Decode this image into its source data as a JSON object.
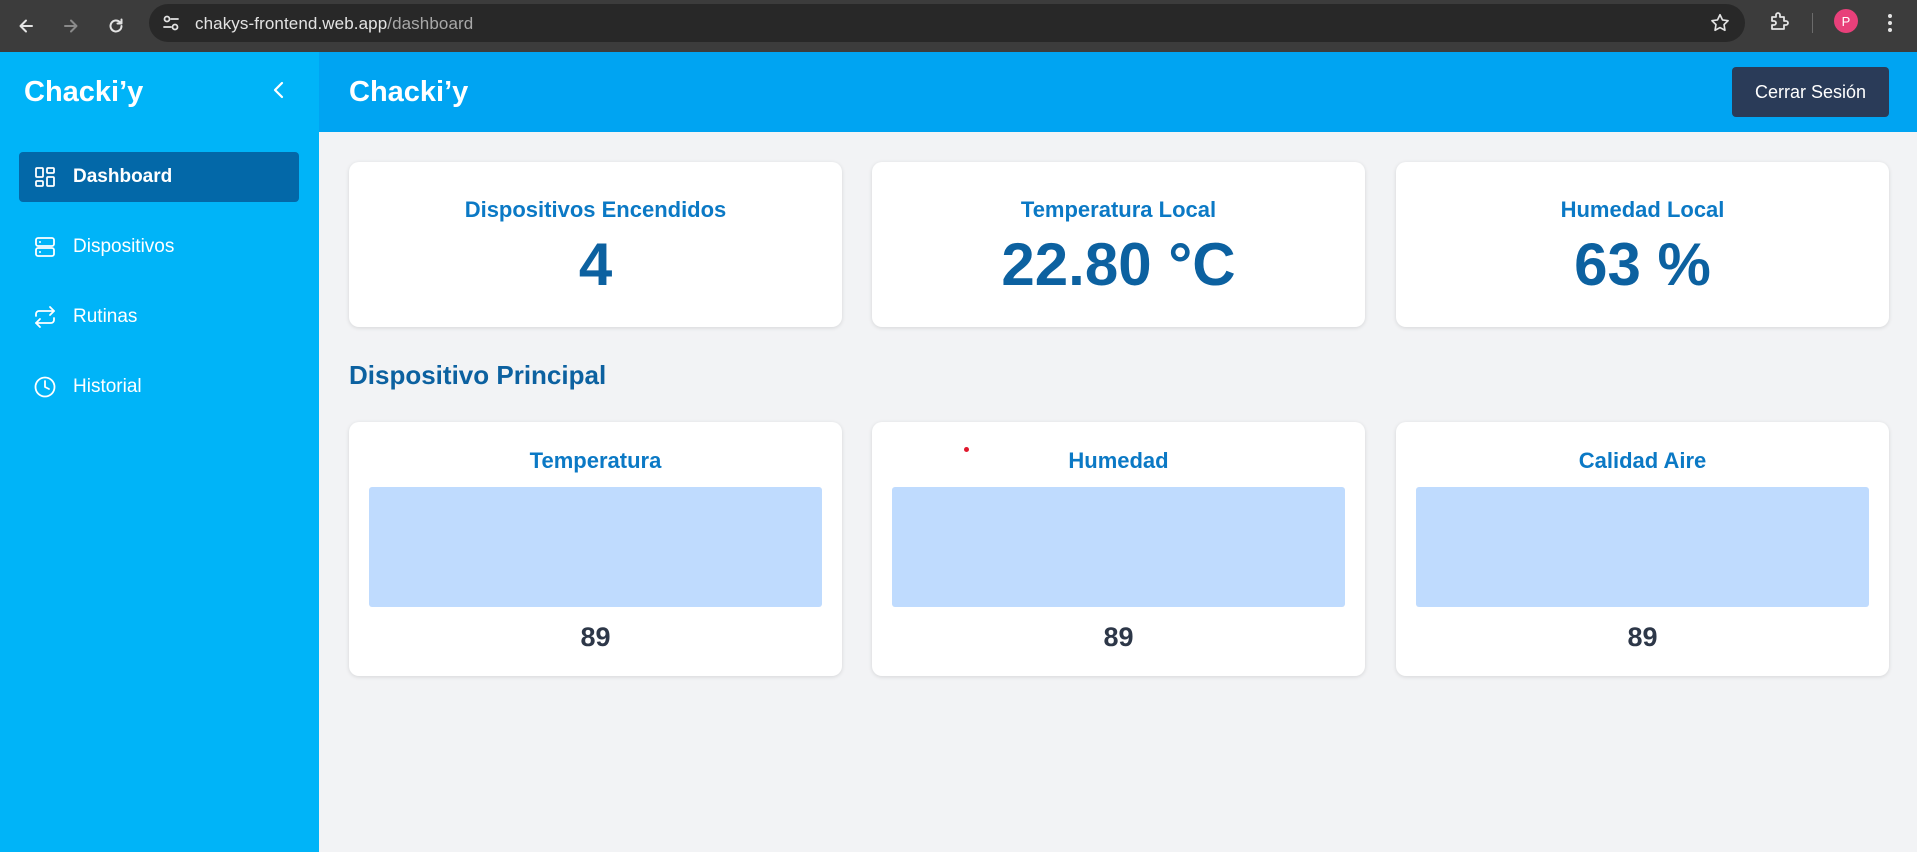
{
  "browser": {
    "url_host": "chakys-frontend.web.app",
    "url_path": "/dashboard",
    "profile_initial": "P",
    "icons": [
      "back-icon",
      "forward-icon",
      "reload-icon",
      "site-info-icon",
      "star-icon",
      "extensions-icon",
      "menu-icon"
    ]
  },
  "sidebar": {
    "brand": "Chacki’y",
    "items": [
      {
        "label": "Dashboard",
        "icon": "dashboard-icon",
        "active": true
      },
      {
        "label": "Dispositivos",
        "icon": "server-icon",
        "active": false
      },
      {
        "label": "Rutinas",
        "icon": "repeat-icon",
        "active": false
      },
      {
        "label": "Historial",
        "icon": "clock-icon",
        "active": false
      }
    ]
  },
  "header": {
    "title": "Chacki’y",
    "logout_label": "Cerrar Sesión"
  },
  "stats": [
    {
      "title": "Dispositivos Encendidos",
      "value": "4"
    },
    {
      "title": "Temperatura Local",
      "value": "22.80 °C"
    },
    {
      "title": "Humedad Local",
      "value": "63 %"
    }
  ],
  "main_device": {
    "section_title": "Dispositivo Principal",
    "cards": [
      {
        "title": "Temperatura",
        "value": "89"
      },
      {
        "title": "Humedad",
        "value": "89"
      },
      {
        "title": "Calidad Aire",
        "value": "89"
      }
    ]
  },
  "colors": {
    "sidebar": "#00b4f8",
    "header": "#00a4f2",
    "active_item": "#0368a8",
    "logout_button": "#2a3b58",
    "accent_text": "#0b79c5",
    "value_text": "#0c61a0",
    "chart_placeholder": "#bfdbfe"
  }
}
